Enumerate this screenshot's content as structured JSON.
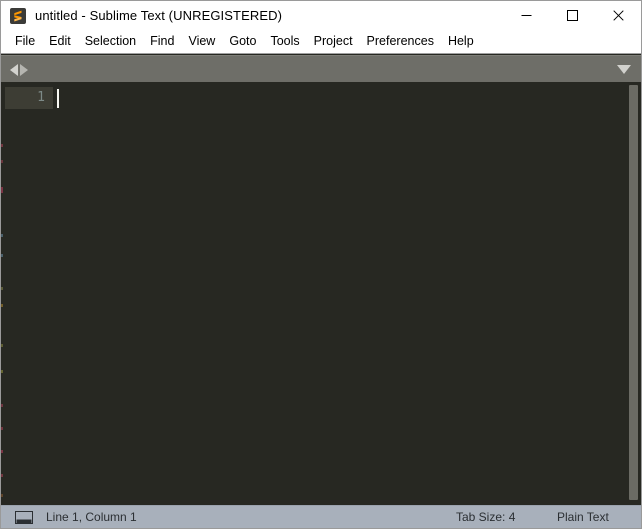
{
  "window": {
    "title": "untitled - Sublime Text (UNREGISTERED)",
    "app_icon_name": "sublime-text-logo",
    "controls": {
      "minimize_label": "Minimize",
      "maximize_label": "Maximize",
      "close_label": "Close"
    }
  },
  "menubar": {
    "items": [
      {
        "label": "File"
      },
      {
        "label": "Edit"
      },
      {
        "label": "Selection"
      },
      {
        "label": "Find"
      },
      {
        "label": "View"
      },
      {
        "label": "Goto"
      },
      {
        "label": "Tools"
      },
      {
        "label": "Project"
      },
      {
        "label": "Preferences"
      },
      {
        "label": "Help"
      }
    ]
  },
  "tabbar": {
    "scroll_left_icon": "caret-left-icon",
    "scroll_right_icon": "caret-right-icon",
    "dropdown_icon": "chevron-down-icon",
    "tabs": []
  },
  "editor": {
    "line_numbers": [
      "1"
    ],
    "content": "",
    "caret_visible": true,
    "background_color": "#272822",
    "current_line_gutter_color": "#3d3d34",
    "line_number_color": "#7d8a87",
    "caret_color": "#f8f8f2"
  },
  "scrollbar": {
    "orientation": "vertical",
    "thumb_color": "#6b6b64"
  },
  "statusbar": {
    "panel_icon": "console-panel-icon",
    "position": "Line 1, Column 1",
    "tab_size": "Tab Size: 4",
    "syntax": "Plain Text",
    "background_color": "#a8b0bb"
  },
  "colors": {
    "accent": "#ff9800",
    "titlebar_bg": "#ffffff",
    "tabbar_bg": "#6e6e68"
  }
}
